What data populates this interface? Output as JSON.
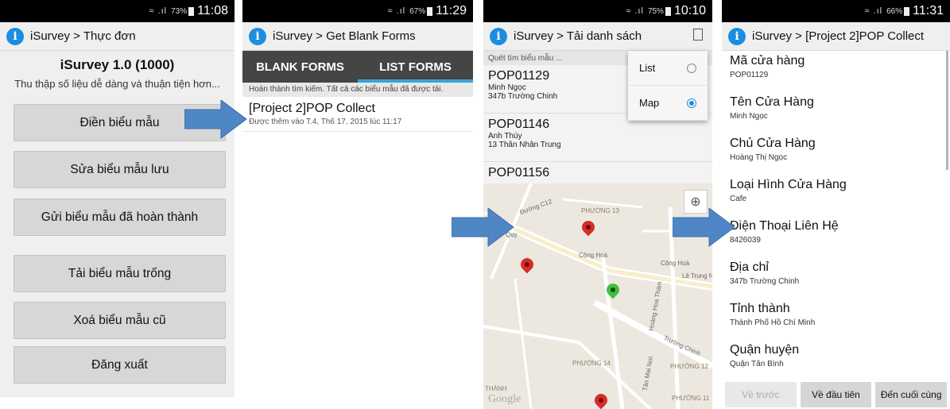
{
  "screens": [
    {
      "status": {
        "percent": "73%",
        "time": "11:08"
      },
      "title": "iSurvey > Thực đơn",
      "app_name": "iSurvey 1.0 (1000)",
      "tagline": "Thu thập số liệu dễ dàng và thuận tiện hơn...",
      "buttons": [
        "Điền biểu mẫu",
        "Sửa biểu mẫu lưu",
        "Gửi biểu mẫu đã hoàn thành",
        "Tải biểu mẫu trống",
        "Xoá biểu mẫu cũ",
        "Đăng xuất"
      ]
    },
    {
      "status": {
        "percent": "67%",
        "time": "11:29"
      },
      "title": "iSurvey > Get Blank Forms",
      "tabs": [
        "BLANK FORMS",
        "LIST FORMS"
      ],
      "message": "Hoàn thành tìm kiếm. Tất cả các biểu mẫu đã được tải.",
      "forms": [
        {
          "name": "[Project 2]POP Collect",
          "added": "Được thêm vào T.4, Th6 17, 2015 lúc 11:17"
        }
      ]
    },
    {
      "status": {
        "percent": "75%",
        "time": "10:10"
      },
      "title": "iSurvey > Tải danh sách",
      "search_placeholder": "Quét tìm biểu mẫu ...",
      "items": [
        {
          "code": "POP01129",
          "name": "Minh Ngọc",
          "address": "347b Trường Chinh"
        },
        {
          "code": "POP01146",
          "name": "Anh Thúy",
          "address": "13 Thân Nhân Trung"
        },
        {
          "code": "POP01156",
          "name": "",
          "address": ""
        }
      ],
      "menu": [
        {
          "label": "List",
          "selected": false
        },
        {
          "label": "Map",
          "selected": true
        }
      ],
      "map_labels": {
        "l1": "Đường C12",
        "l2": "PHƯỜNG 13",
        "l3": "Cộng Hoà",
        "l4": "Cộng Hoà",
        "l5": "Lê Trung N",
        "l6": "Hoàng Hoa Thám",
        "l7": "Trường Chinh",
        "l8": "PHƯỜNG 14",
        "l9": "PHƯỜNG 12",
        "l10": "PHƯỜNG 11",
        "l11": "Tân Mai Nơi",
        "l12": "Quy",
        "l13": "THÀNH",
        "l14": "Google"
      }
    },
    {
      "status": {
        "percent": "66%",
        "time": "11:31"
      },
      "title": "iSurvey > [Project 2]POP Collect",
      "fields": [
        {
          "label": "Mã cửa hàng",
          "value": "POP01129"
        },
        {
          "label": "Tên Cửa Hàng",
          "value": "Minh Ngọc"
        },
        {
          "label": "Chủ Cửa Hàng",
          "value": "Hoàng Thị Ngọc"
        },
        {
          "label": "Loại Hình Cửa Hàng",
          "value": "Cafe"
        },
        {
          "label": "Điện Thoại Liên Hệ",
          "value": "8426039"
        },
        {
          "label": "Địa chỉ",
          "value": "347b Trường Chinh"
        },
        {
          "label": "Tỉnh thành",
          "value": "Thành Phố Hồ Chí Minh"
        },
        {
          "label": "Quận huyện",
          "value": "Quận Tân Bình"
        }
      ],
      "nav": [
        "Về trước",
        "Về đầu tiên",
        "Đến cuối cùng"
      ]
    }
  ],
  "colors": {
    "arrow": "#4f86c6",
    "accent": "#1d8de0",
    "tab_bar": "#454545",
    "tab_indicator": "#3aa3d8"
  }
}
